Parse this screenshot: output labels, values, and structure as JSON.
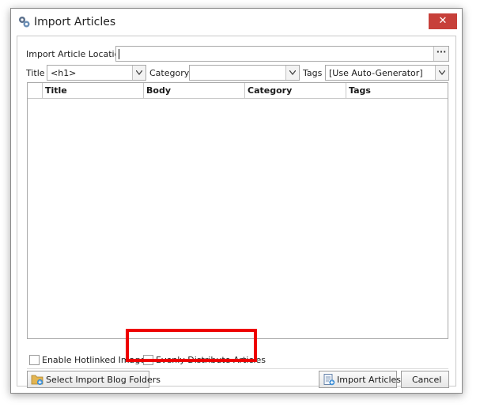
{
  "window": {
    "title": "Import Articles",
    "close_glyph": "✕",
    "icon": "gears-icon"
  },
  "form": {
    "location_label": "Import Article Location",
    "location_value": "",
    "browse_label": "···",
    "title_label": "Title",
    "title_value": "<h1>",
    "category_label": "Category",
    "category_value": "",
    "tags_label": "Tags",
    "tags_value": "[Use Auto-Generator]"
  },
  "grid": {
    "columns": [
      "Title",
      "Body",
      "Category",
      "Tags"
    ],
    "rows": []
  },
  "options": {
    "hotlinked_label": "Enable Hotlinked Images",
    "hotlinked_checked": false,
    "distribute_label": "Evenly Distribute Articles",
    "distribute_checked": false
  },
  "buttons": {
    "select_folders": "Select Import Blog Folders",
    "import": "Import Articles",
    "cancel": "Cancel"
  },
  "colors": {
    "close_button": "#c7403a",
    "highlight": "#ee0000"
  }
}
